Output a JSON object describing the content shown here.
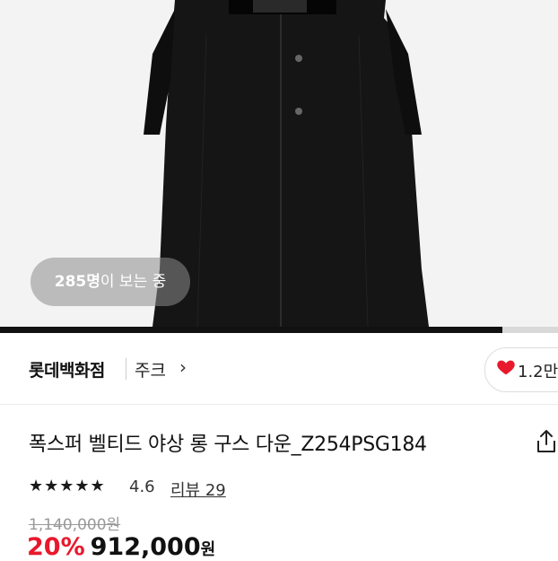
{
  "product_image": {
    "alt_icon": "coat-image",
    "viewers_count": "285명",
    "viewers_suffix": "이 보는 중",
    "gallery_progress": 0.9
  },
  "store": {
    "name": "롯데백화점",
    "brand": "주크",
    "brand_chevron": "›",
    "like_count": "1.2만",
    "like_color": "#e8192c"
  },
  "product": {
    "title": "폭스퍼 벨티드 야상 롱 구스 다운_Z254PSG184",
    "stars": "★★★★★",
    "rating": "4.6",
    "reviews": "리뷰 29",
    "original_price": "1,140,000원",
    "discount": "20%",
    "price": "912,000",
    "currency": "원",
    "discount_color": "#e8192c"
  }
}
